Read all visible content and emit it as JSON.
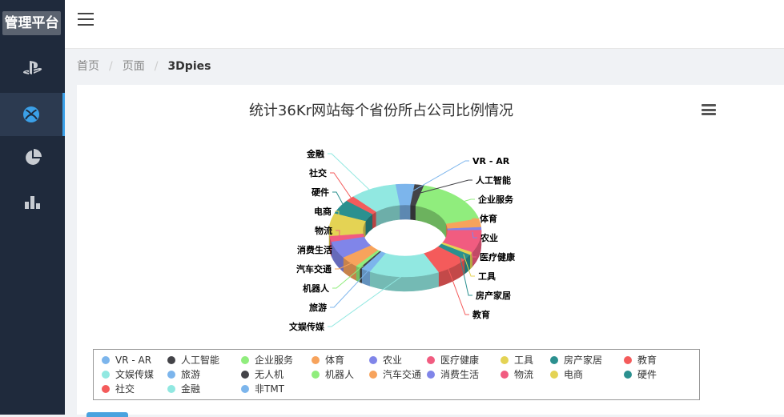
{
  "app": {
    "title": "管理平台"
  },
  "sidebar": {
    "items": [
      {
        "icon": "playstation-icon",
        "active": false
      },
      {
        "icon": "xbox-icon",
        "active": true
      },
      {
        "icon": "pie-chart-icon",
        "active": false
      },
      {
        "icon": "bar-chart-icon",
        "active": false
      }
    ]
  },
  "breadcrumb": {
    "home": "首页",
    "page": "页面",
    "current": "3Dpies"
  },
  "chart_data": {
    "type": "pie",
    "title": "统计36Kr网站每个省份所占公司比例情况",
    "donut": true,
    "three_d": true,
    "slices": [
      {
        "name": "VR - AR",
        "value": 2,
        "color": "#7cb5ec",
        "labeled": true
      },
      {
        "name": "人工智能",
        "value": 2,
        "color": "#434348",
        "labeled": true
      },
      {
        "name": "企业服务",
        "value": 17,
        "color": "#90ed7d",
        "labeled": true
      },
      {
        "name": "体育",
        "value": 3,
        "color": "#f7a35c",
        "labeled": true
      },
      {
        "name": "农业",
        "value": 1,
        "color": "#8085e9",
        "labeled": true
      },
      {
        "name": "医疗健康",
        "value": 8,
        "color": "#f15c80",
        "labeled": true
      },
      {
        "name": "工具",
        "value": 1,
        "color": "#e4d354",
        "labeled": true
      },
      {
        "name": "房产家居",
        "value": 2,
        "color": "#2b908f",
        "labeled": true
      },
      {
        "name": "教育",
        "value": 7,
        "color": "#f45b5b",
        "labeled": true
      },
      {
        "name": "文娱传媒",
        "value": 15,
        "color": "#91e8e1",
        "labeled": true
      },
      {
        "name": "旅游",
        "value": 2,
        "color": "#7cb5ec",
        "labeled": true
      },
      {
        "name": "无人机",
        "value": 0.5,
        "color": "#434348",
        "labeled": false
      },
      {
        "name": "机器人",
        "value": 1,
        "color": "#90ed7d",
        "labeled": true
      },
      {
        "name": "汽车交通",
        "value": 4,
        "color": "#f7a35c",
        "labeled": true
      },
      {
        "name": "消费生活",
        "value": 6,
        "color": "#8085e9",
        "labeled": true
      },
      {
        "name": "物流",
        "value": 2,
        "color": "#f15c80",
        "labeled": true
      },
      {
        "name": "电商",
        "value": 8,
        "color": "#e4d354",
        "labeled": true
      },
      {
        "name": "硬件",
        "value": 5,
        "color": "#2b908f",
        "labeled": true
      },
      {
        "name": "社交",
        "value": 2,
        "color": "#f45b5b",
        "labeled": true
      },
      {
        "name": "金融",
        "value": 10,
        "color": "#91e8e1",
        "labeled": true
      },
      {
        "name": "非TMT",
        "value": 2,
        "color": "#7cb5ec",
        "labeled": false
      }
    ],
    "legend_position": "bottom"
  }
}
